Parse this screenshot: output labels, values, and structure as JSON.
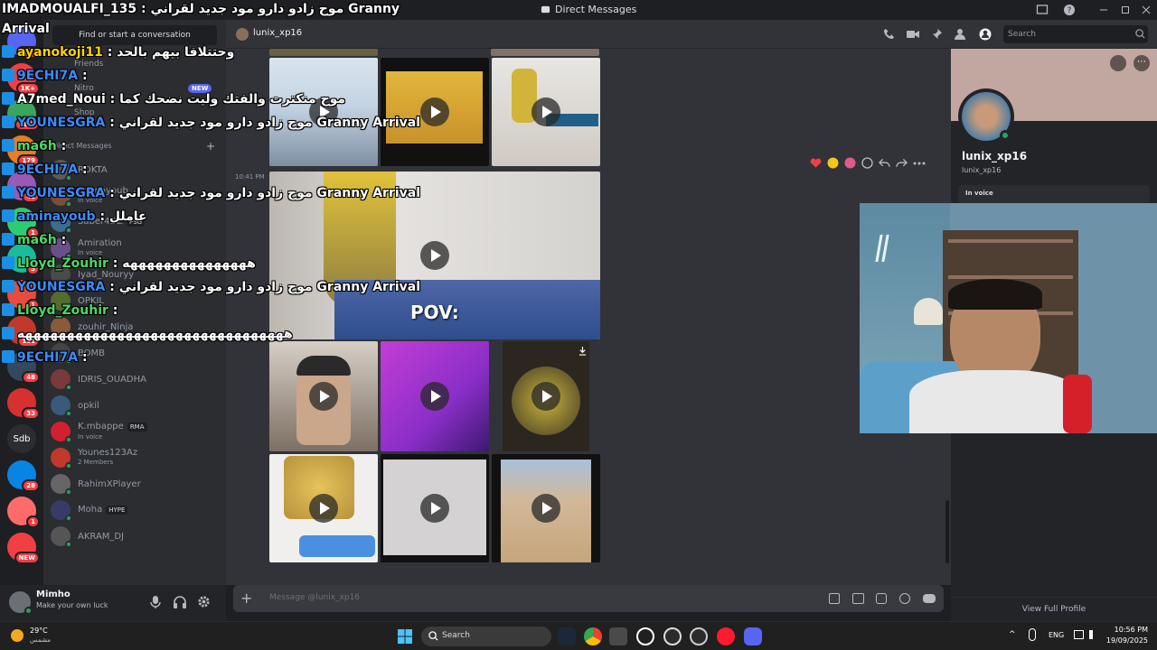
{
  "titlebar": {
    "title": "Direct Messages"
  },
  "overlay": {
    "heading_left": "IMADMOUALFI_135 :",
    "heading_right": "موح زادو دارو مود جديد لقراني Granny",
    "arrival": "Arrival",
    "lines": [
      {
        "user": "ayanokoji11",
        "color": "y",
        "text": ": وحتتلافا بيهم بالحد"
      },
      {
        "user": "9ECHI7A",
        "color": "n",
        "text": ":"
      },
      {
        "user": "A7med_Noui",
        "color": "w",
        "text": ": موح منكترت والفتك وليت نضحك كما"
      },
      {
        "user": "YOUNESGRA",
        "color": "n",
        "text": ": موح زادو دارو مود جديد لقراني Granny Arrival"
      },
      {
        "user": "ma6h",
        "color": "g",
        "text": ":"
      },
      {
        "user": "9ECHI7A",
        "color": "n",
        "text": ":"
      },
      {
        "user": "YOUNESGRA",
        "color": "n",
        "text": ": موح زادو دارو مود جديد لقراني Granny Arrival"
      },
      {
        "user": "aminayoub",
        "color": "n",
        "text": ": عاملل"
      },
      {
        "user": "ma6h",
        "color": "g",
        "text": ":"
      },
      {
        "user": "Lloyd_Zouhir",
        "color": "g",
        "text": ": هههههههههههههههه"
      },
      {
        "user": "YOUNESGRA",
        "color": "n",
        "text": ": موح زادو دارو مود جديد لقراني Granny Arrival"
      },
      {
        "user": "Lloyd_Zouhir",
        "color": "g",
        "text": ":"
      },
      {
        "user": "",
        "color": "w",
        "text": "ههههههههههههههههههههههههههههههههه"
      },
      {
        "user": "9ECHI7A",
        "color": "n",
        "text": ":"
      }
    ]
  },
  "rail": {
    "servers": [
      {
        "label": "",
        "badge": "1K+",
        "color": "#5865f2"
      },
      {
        "label": "",
        "badge": "1K+",
        "color": "#f23f43"
      },
      {
        "label": "",
        "badge": "NEW",
        "color": "#3ba55d"
      },
      {
        "label": "",
        "badge": "179",
        "color": "#e67e22"
      },
      {
        "label": "",
        "badge": "41",
        "color": "#9b59b6"
      },
      {
        "label": "",
        "badge": "1",
        "color": "#2ecc71"
      },
      {
        "label": "",
        "badge": "5",
        "color": "#1abc9c"
      },
      {
        "label": "",
        "badge": "1",
        "color": "#e74c3c"
      },
      {
        "label": "",
        "badge": "161",
        "color": "#c0392b"
      },
      {
        "label": "",
        "badge": "48",
        "color": "#34495e"
      },
      {
        "label": "",
        "badge": "33",
        "color": "#d63031"
      },
      {
        "label": "Sdb",
        "badge": "",
        "color": "#2b2d31"
      },
      {
        "label": "",
        "badge": "28",
        "color": "#0984e3"
      },
      {
        "label": "",
        "badge": "1",
        "color": "#ff6b6b"
      },
      {
        "label": "",
        "badge": "NEW",
        "color": "#f23f43"
      }
    ]
  },
  "dm": {
    "search_placeholder": "Find or start a conversation",
    "nav": [
      "Friends",
      "Nitro",
      "Shop"
    ],
    "nav_new": "NEW",
    "section": "Direct Messages",
    "items": [
      {
        "name": "ROKTA",
        "sub": ""
      },
      {
        "name": "aminayoub",
        "sub": "In voice"
      },
      {
        "name": "Saber4DZ",
        "sub": "",
        "tag": "PSG"
      },
      {
        "name": "Amiration",
        "sub": "In voice"
      },
      {
        "name": "Iyad_Nouryy",
        "sub": ""
      },
      {
        "name": "OPKIL",
        "sub": ""
      },
      {
        "name": "zouhir_Ninja",
        "sub": ""
      },
      {
        "name": "BOMB",
        "sub": ""
      },
      {
        "name": "IDRIS_OUADHA",
        "sub": ""
      },
      {
        "name": "opkil",
        "sub": ""
      },
      {
        "name": "K.mbappe",
        "sub": "In voice",
        "tag": "RMA"
      },
      {
        "name": "Younes123Az",
        "sub": "2 Members"
      },
      {
        "name": "RahimXPlayer",
        "sub": ""
      },
      {
        "name": "Moha",
        "sub": "",
        "tag": "HYPE"
      },
      {
        "name": "AKRAM_DJ",
        "sub": ""
      }
    ]
  },
  "user": {
    "name": "Mimho",
    "status": "Make your own luck"
  },
  "chat": {
    "recipient": "lunix_xp16",
    "search_placeholder": "Search",
    "timestamp": "10:41 PM",
    "pov_caption": "POV:",
    "composer_placeholder": "Message @lunix_xp16"
  },
  "profile": {
    "display_name": "lunix_xp16",
    "username": "lunix_xp16",
    "in_voice": "In voice",
    "view_full": "View Full Profile"
  },
  "taskbar": {
    "weather_temp": "29°C",
    "weather_desc": "مشمس",
    "search_label": "Search",
    "lang": "ENG",
    "time": "10:56 PM",
    "date": "19/09/2025"
  },
  "colors": {
    "accent": "#5865f2",
    "online": "#23a55a",
    "danger": "#f23f43",
    "bg_chat": "#313338",
    "bg_side": "#2b2d31",
    "bg_dark": "#1e1f22"
  }
}
